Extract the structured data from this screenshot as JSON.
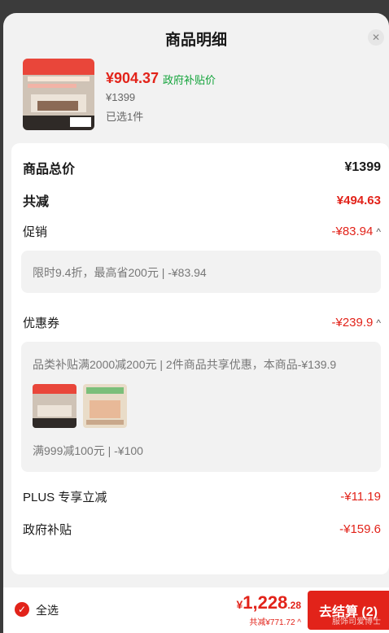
{
  "header": {
    "title": "商品明细",
    "close_icon": "close-icon"
  },
  "product": {
    "price": "¥904.37",
    "gov_tag": "政府补贴价",
    "original_price": "¥1399",
    "selected": "已选1件"
  },
  "summary": {
    "total_label": "商品总价",
    "total_value": "¥1399",
    "discount_label": "共减",
    "discount_value": "¥494.63",
    "promo_label": "促销",
    "promo_value": "-¥83.94",
    "promo_detail": "限时9.4折，最高省200元 | -¥83.94",
    "coupon_label": "优惠券",
    "coupon_value": "-¥239.9",
    "coupon_detail_1": "品类补贴满2000减200元 | 2件商品共享优惠，本商品-¥139.9",
    "coupon_detail_2": "满999减100元 | -¥100",
    "plus_label": "PLUS 专享立减",
    "plus_value": "-¥11.19",
    "gov_label": "政府补贴",
    "gov_value": "-¥159.6"
  },
  "footer": {
    "select_all": "全选",
    "currency": "¥",
    "total_int": "1,228",
    "total_dec": ".28",
    "saved": "共减¥771.72",
    "checkout": "去结算 (2)",
    "watermark": "服饰司爱博士"
  },
  "colors": {
    "accent": "#e2231a",
    "green": "#12a33a"
  }
}
